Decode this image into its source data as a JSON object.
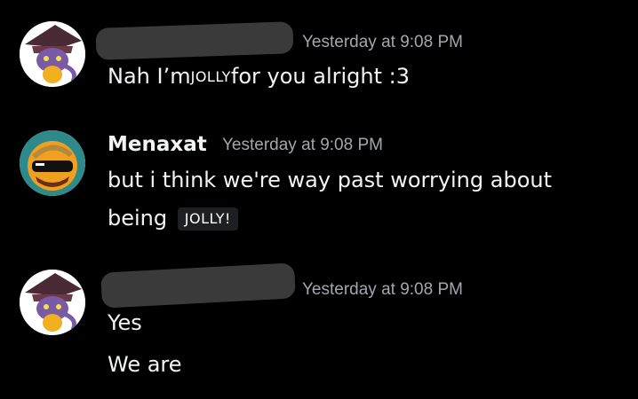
{
  "messages": [
    {
      "username": "",
      "timestamp": "Yesterday at 9:08 PM",
      "lines": [
        {
          "before": "Nah I’m",
          "emote": "JOLLY",
          "after": "for you alright :3"
        }
      ]
    },
    {
      "username": "Menaxat",
      "timestamp": "Yesterday at 9:08 PM",
      "lines": [
        {
          "text": "but i think we're way past worrying about"
        },
        {
          "before": "being ",
          "emote": "JOLLY!"
        }
      ]
    },
    {
      "username": "",
      "timestamp": "Yesterday at 9:08 PM",
      "lines": [
        {
          "text": "Yes"
        },
        {
          "text": "We are"
        }
      ]
    }
  ],
  "colors": {
    "background": "#000000",
    "text": "#f2f3f5",
    "timestamp": "#a3a6ad",
    "redaction": "#3a3a3a"
  },
  "icons": {
    "avatar_1": "cat-witch-avatar-icon",
    "avatar_2": "orange-sunglasses-avatar-icon",
    "avatar_3": "cat-witch-avatar-icon"
  }
}
